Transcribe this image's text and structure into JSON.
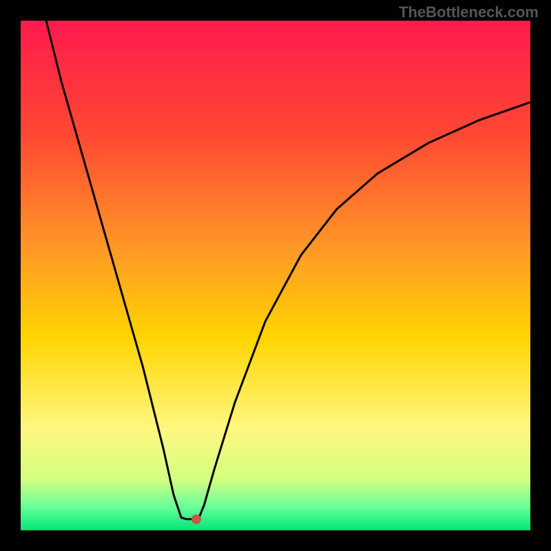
{
  "watermark": "TheBottleneck.com",
  "colors": {
    "top": "#ff1a4d",
    "mid1": "#ff6633",
    "mid2": "#ffd400",
    "mid3": "#fff799",
    "bottom": "#00e676",
    "curve": "#000000",
    "dot": "#c25a4a",
    "frame": "#000000"
  },
  "chart_data": {
    "type": "line",
    "title": "",
    "xlabel": "",
    "ylabel": "",
    "xlim": [
      0,
      100
    ],
    "ylim": [
      0,
      100
    ],
    "series": [
      {
        "name": "curve",
        "x": [
          5,
          8,
          12,
          16,
          20,
          24,
          28,
          30,
          31.5,
          32.5,
          34,
          35,
          36,
          38,
          42,
          48,
          55,
          62,
          70,
          80,
          90,
          100
        ],
        "y": [
          100,
          88,
          74,
          60,
          46,
          32,
          16,
          7,
          2.5,
          2.2,
          2.2,
          2.5,
          5,
          12,
          25,
          41,
          54,
          63,
          70,
          76,
          80.5,
          84
        ]
      }
    ],
    "marker": {
      "x": 34.5,
      "y": 2.1
    },
    "gradient_stops": [
      {
        "pos": 0.0,
        "color": "#ff1a4d"
      },
      {
        "pos": 0.22,
        "color": "#ff4733"
      },
      {
        "pos": 0.45,
        "color": "#ff9926"
      },
      {
        "pos": 0.62,
        "color": "#ffd400"
      },
      {
        "pos": 0.8,
        "color": "#fff780"
      },
      {
        "pos": 0.9,
        "color": "#d4ff80"
      },
      {
        "pos": 0.955,
        "color": "#66ff99"
      },
      {
        "pos": 1.0,
        "color": "#00e676"
      }
    ]
  }
}
